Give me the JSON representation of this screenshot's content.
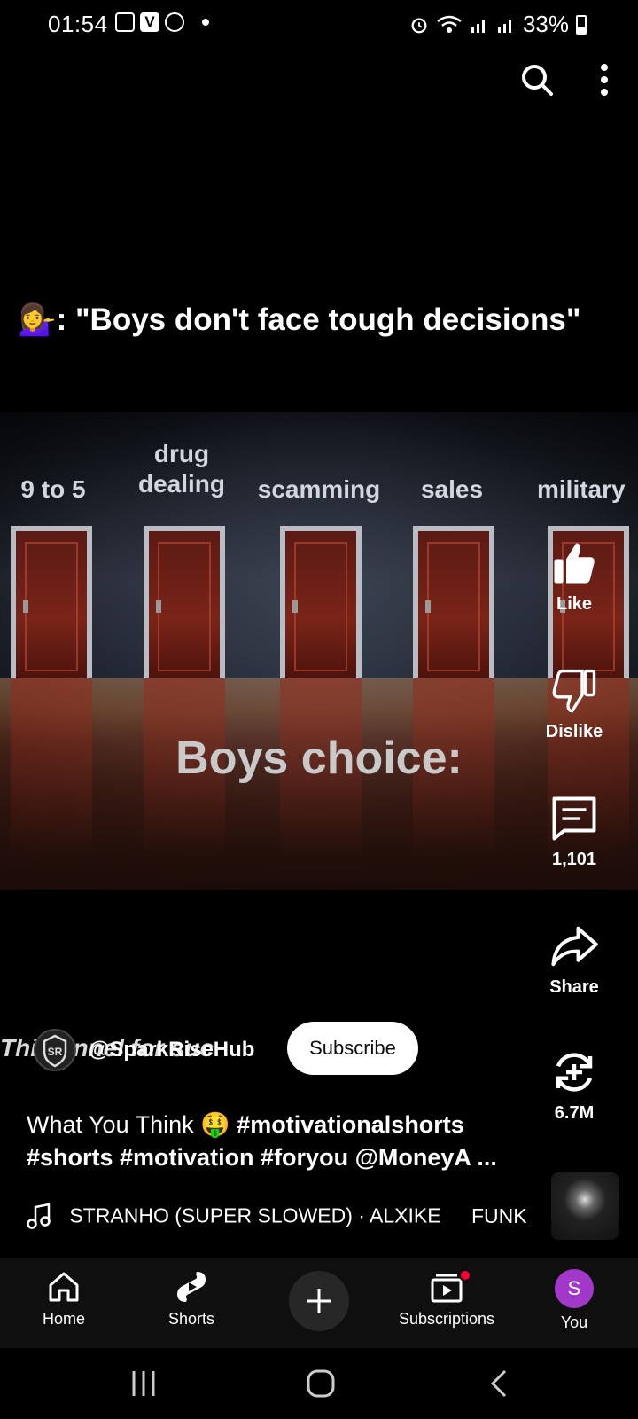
{
  "status_bar": {
    "time": "01:54",
    "battery": "33%"
  },
  "video": {
    "caption": "💁‍♀️: \"Boys don't face tough decisions\"",
    "door_labels": [
      "9 to 5",
      "drug dealing",
      "scamming",
      "sales",
      "military"
    ],
    "overlay_text": "Boys choice:"
  },
  "rail": {
    "like_label": "Like",
    "dislike_label": "Dislike",
    "comments_count": "1,101",
    "share_label": "Share",
    "remix_count": "6.7M"
  },
  "channel": {
    "watermark": "Thi  hannel for suc",
    "handle": "@SparkRiseHub",
    "subscribe_label": "Subscribe"
  },
  "description": {
    "line1_text": "What You Think 🤑 ",
    "line1_tag": "#motivationalshorts",
    "line2": "#shorts #motivation #foryou @MoneyA ..."
  },
  "music": {
    "track": "STRANHO (SUPER SLOWED) · ALXIKE",
    "extra": "FUNK"
  },
  "nav": {
    "home": "Home",
    "shorts": "Shorts",
    "subscriptions": "Subscriptions",
    "you": "You",
    "you_initial": "S"
  },
  "colors": {
    "background": "#000000",
    "nav_bg": "#0f0f0f",
    "you_avatar": "#a238c9",
    "notification": "#ff0033",
    "door": "#7a2418"
  },
  "icons": [
    "search-icon",
    "more-vert-icon",
    "thumb-up-icon",
    "thumb-down-icon",
    "comment-icon",
    "share-icon",
    "remix-icon",
    "music-note-icon",
    "home-icon",
    "shorts-icon",
    "plus-icon",
    "subscriptions-icon",
    "recents-icon",
    "home-circle-icon",
    "back-icon"
  ]
}
